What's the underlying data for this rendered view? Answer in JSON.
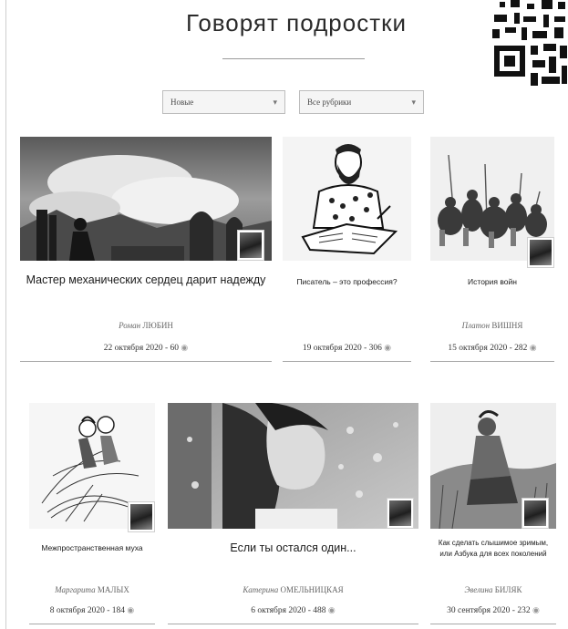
{
  "page": {
    "title": "Говорят подростки"
  },
  "filters": {
    "sort": "Новые",
    "category": "Все рубрики"
  },
  "icons": {
    "views": "eye-icon",
    "dropdown": "chevron-down-icon"
  },
  "cards": [
    {
      "title": "Мастер механических сердец дарит надежду",
      "author_first": "Роман",
      "author_last": "ЛЮБИН",
      "date": "22 октября 2020",
      "views": "60"
    },
    {
      "title": "Писатель – это профессия?",
      "author_first": "",
      "author_last": "",
      "date": "19 октября 2020",
      "views": "306"
    },
    {
      "title": "История войн",
      "author_first": "Платон",
      "author_last": "ВИШНЯ",
      "date": "15 октября 2020",
      "views": "282"
    },
    {
      "title": "Межпространственная муха",
      "author_first": "Маргарита",
      "author_last": "МАЛЫХ",
      "date": "8 октября 2020",
      "views": "184"
    },
    {
      "title": "Если ты остался один...",
      "author_first": "Катерина",
      "author_last": "ОМЕЛЬНИЦКАЯ",
      "date": "6 октября 2020",
      "views": "488"
    },
    {
      "title": "Как сделать слышимое зримым, или Азбука для всех поколений",
      "author_first": "Эвелина",
      "author_last": "БИЛЯК",
      "date": "30 сентября 2020",
      "views": "232"
    }
  ]
}
